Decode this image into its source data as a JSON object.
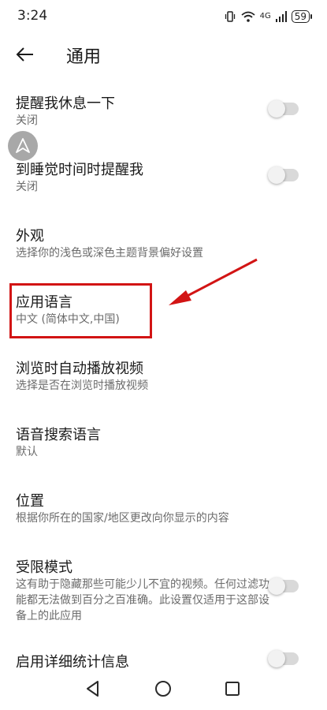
{
  "status_bar": {
    "time": "3:24",
    "network": "4G",
    "battery": "59"
  },
  "header": {
    "title": "通用"
  },
  "settings": [
    {
      "title": "提醒我休息一下",
      "subtitle": "关闭"
    },
    {
      "title": "到睡觉时间时提醒我",
      "subtitle": "关闭"
    },
    {
      "title": "外观",
      "subtitle": "选择你的浅色或深色主题背景偏好设置"
    },
    {
      "title": "应用语言",
      "subtitle": "中文 (简体中文,中国)"
    },
    {
      "title": "浏览时自动播放视频",
      "subtitle": "选择是否在浏览时播放视频"
    },
    {
      "title": "语音搜索语言",
      "subtitle": "默认"
    },
    {
      "title": "位置",
      "subtitle": "根据你所在的国家/地区更改向你显示的内容"
    },
    {
      "title": "受限模式",
      "subtitle": "这有助于隐藏那些可能少儿不宜的视频。任何过滤功能都无法做到百分之百准确。此设置仅适用于这部设备上的此应用"
    },
    {
      "title": "启用详细统计信息",
      "subtitle": ""
    }
  ],
  "toggles": {
    "break_reminder": false,
    "bedtime_reminder": false,
    "restricted_mode": false,
    "stats_for_nerds": false
  },
  "colors": {
    "highlight": "#d21414",
    "toggle_track": "#d9d9d9",
    "toggle_knob": "#f2f2f2"
  }
}
